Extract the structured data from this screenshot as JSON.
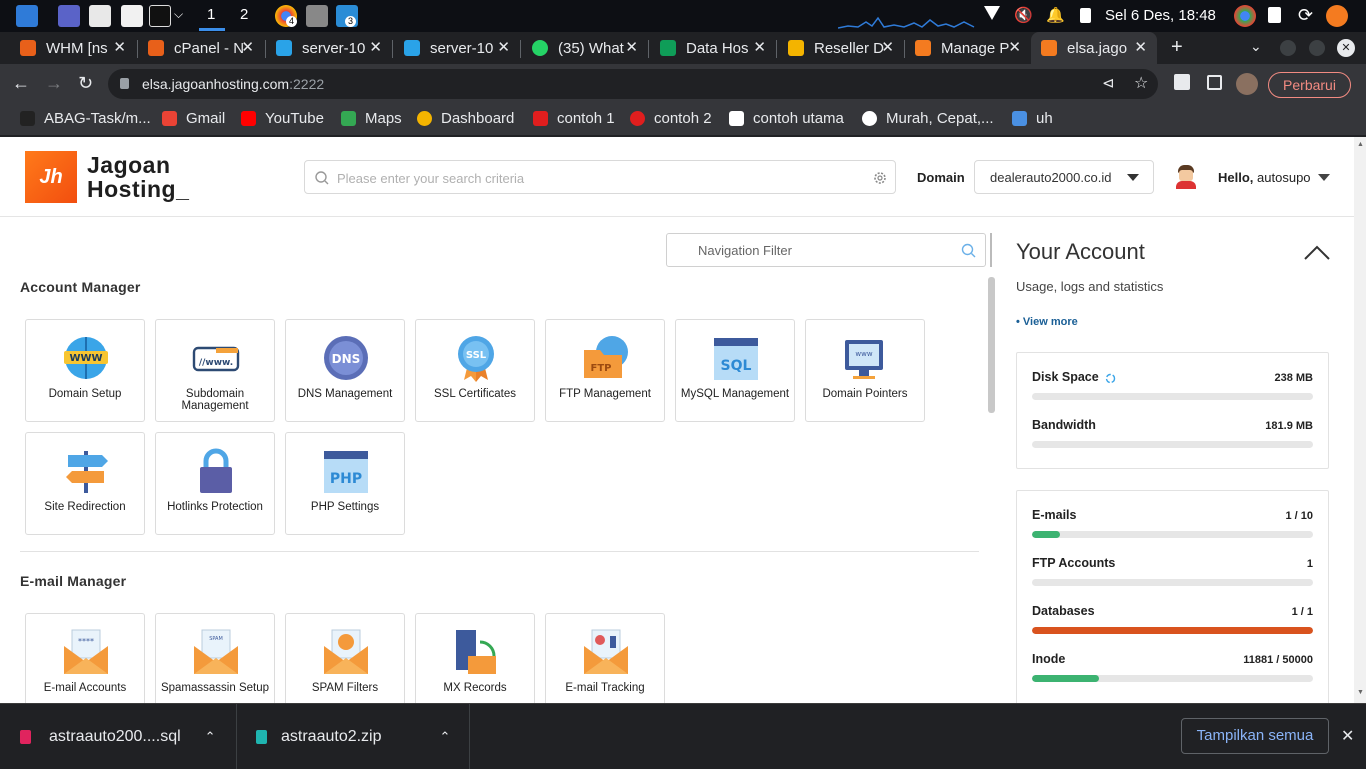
{
  "taskbar": {
    "workspaces": [
      "1",
      "2"
    ],
    "badges": [
      "4",
      "3"
    ],
    "clock": "Sel  6 Des, 18:48"
  },
  "tabs": [
    {
      "title": "WHM [ns",
      "color": "#e8601a",
      "icon": "cpanel-icon"
    },
    {
      "title": "cPanel - N",
      "color": "#e8601a",
      "icon": "cpanel-icon"
    },
    {
      "title": "server-10",
      "color": "#2aa3e8",
      "icon": "terminal-icon"
    },
    {
      "title": "server-10",
      "color": "#2aa3e8",
      "icon": "terminal-icon"
    },
    {
      "title": "(35) What",
      "color": "#25d366",
      "icon": "whatsapp-icon"
    },
    {
      "title": "Data Hos",
      "color": "#0f9d58",
      "icon": "sheets-icon"
    },
    {
      "title": "Reseller D",
      "color": "#f4b400",
      "icon": "drive-icon"
    },
    {
      "title": "Manage P",
      "color": "#f47b20",
      "icon": "jagoan-icon"
    },
    {
      "title": "elsa.jago",
      "color": "#f47b20",
      "icon": "jagoan-icon",
      "active": true
    }
  ],
  "address": {
    "host": "elsa.jagoanhosting.com",
    "port": ":2222",
    "update_label": "Perbarui"
  },
  "bookmarks": [
    {
      "label": "ABAG-Task/m...",
      "color": "#222222"
    },
    {
      "label": "Gmail",
      "color": "#ea4335"
    },
    {
      "label": "YouTube",
      "color": "#ff0000"
    },
    {
      "label": "Maps",
      "color": "#34a853"
    },
    {
      "label": "Dashboard",
      "color": "#f4b400"
    },
    {
      "label": "contoh 1",
      "color": "#e01e1e"
    },
    {
      "label": "contoh 2",
      "color": "#e01e1e"
    },
    {
      "label": "contoh utama",
      "color": "#ffffff"
    },
    {
      "label": "Murah, Cepat,...",
      "color": "#ffffff"
    },
    {
      "label": "uh",
      "color": "#4a90e2"
    }
  ],
  "header": {
    "logo_mark": "Jh",
    "logo_line1": "Jagoan",
    "logo_line2": "Hosting_",
    "search_placeholder": "Please enter your search criteria",
    "domain_label": "Domain",
    "domain_value": "dealerauto2000.co.id",
    "hello": "Hello,",
    "username": "autosupo"
  },
  "nav_filter_placeholder": "Navigation Filter",
  "sections": {
    "account_manager": {
      "title": "Account Manager",
      "items": [
        {
          "label": "Domain Setup",
          "icon": "globe-www-icon"
        },
        {
          "label": "Subdomain Management",
          "icon": "subdomain-icon"
        },
        {
          "label": "DNS Management",
          "icon": "dns-icon"
        },
        {
          "label": "SSL Certificates",
          "icon": "ssl-badge-icon"
        },
        {
          "label": "FTP Management",
          "icon": "ftp-folder-icon"
        },
        {
          "label": "MySQL Management",
          "icon": "sql-window-icon"
        },
        {
          "label": "Domain Pointers",
          "icon": "monitor-www-icon"
        },
        {
          "label": "Site Redirection",
          "icon": "signpost-icon"
        },
        {
          "label": "Hotlinks Protection",
          "icon": "padlock-icon"
        },
        {
          "label": "PHP Settings",
          "icon": "php-window-icon"
        }
      ]
    },
    "email_manager": {
      "title": "E-mail Manager",
      "items": [
        {
          "label": "E-mail Accounts",
          "icon": "mail-password-icon"
        },
        {
          "label": "Spamassassin Setup",
          "icon": "mail-spam-icon"
        },
        {
          "label": "SPAM Filters",
          "icon": "mail-smile-icon"
        },
        {
          "label": "MX Records",
          "icon": "mail-server-icon"
        },
        {
          "label": "E-mail Tracking",
          "icon": "mail-chart-icon"
        }
      ]
    }
  },
  "account": {
    "title": "Your Account",
    "subtitle": "Usage, logs and statistics",
    "view_more": "• View more",
    "usage": [
      {
        "name": "Disk Space",
        "value": "238 MB",
        "fill": 0
      },
      {
        "name": "Bandwidth",
        "value": "181.9 MB",
        "fill": 0
      }
    ],
    "limits": [
      {
        "name": "E-mails",
        "value": "1 / 10",
        "fill": 0.1,
        "color": "#3cb371"
      },
      {
        "name": "FTP Accounts",
        "value": "1",
        "fill": 0,
        "color": "#3cb371"
      },
      {
        "name": "Databases",
        "value": "1 / 1",
        "fill": 1.0,
        "color": "#d9531e"
      },
      {
        "name": "Inode",
        "value": "11881 / 50000",
        "fill": 0.2376,
        "color": "#3cb371"
      }
    ]
  },
  "downloads": {
    "files": [
      "astraauto200....sql",
      "astraauto2.zip"
    ],
    "show_all": "Tampilkan semua"
  }
}
